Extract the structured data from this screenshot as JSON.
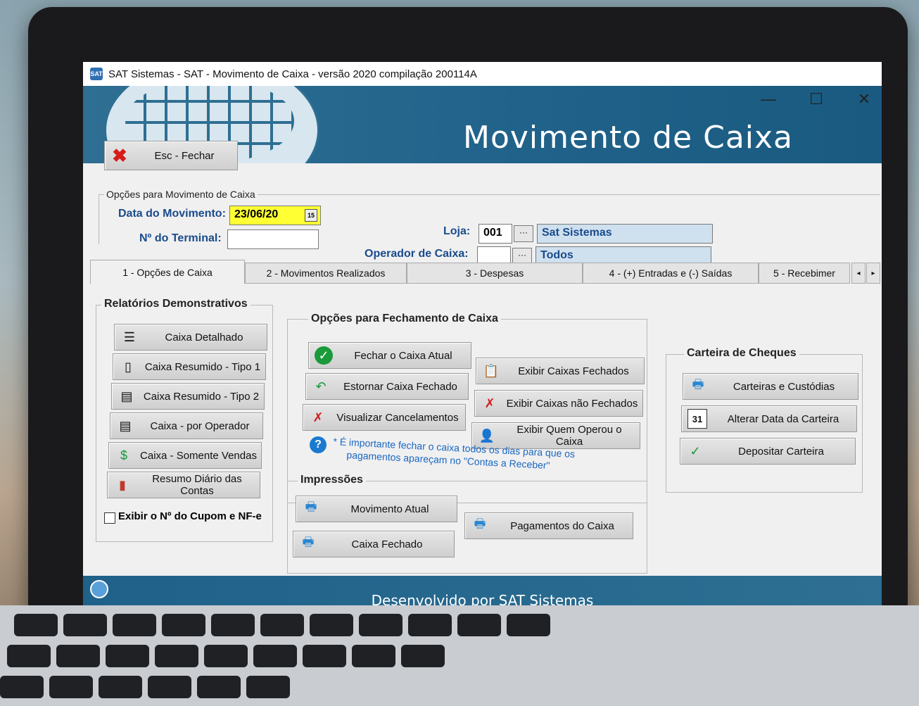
{
  "window": {
    "title": "SAT Sistemas - SAT - Movimento de Caixa - versão 2020 compilação 200114A",
    "minimize": "—",
    "maximize": "☐",
    "close": "✕"
  },
  "header": {
    "title": "Movimento de Caixa"
  },
  "close_button": {
    "label": "Esc - Fechar"
  },
  "options": {
    "group_label": "Opções para Movimento de Caixa",
    "data_label": "Data do Movimento:",
    "data_value": "23/06/20",
    "terminal_label": "Nº do Terminal:",
    "terminal_value": "",
    "loja_label": "Loja:",
    "loja_code": "001",
    "loja_name": "Sat Sistemas",
    "operador_label": "Operador de Caixa:",
    "operador_code": "",
    "operador_name": "Todos",
    "ellipsis": "···"
  },
  "tabs": [
    {
      "label": "1 - Opções de Caixa"
    },
    {
      "label": "2 - Movimentos Realizados"
    },
    {
      "label": "3 - Despesas"
    },
    {
      "label": "4 - (+) Entradas e (-) Saídas"
    },
    {
      "label": "5 - Recebimer"
    }
  ],
  "relatorios": {
    "title": "Relatórios Demonstrativos",
    "buttons": [
      {
        "label": "Caixa Detalhado"
      },
      {
        "label": "Caixa Resumido - Tipo 1"
      },
      {
        "label": "Caixa Resumido - Tipo 2"
      },
      {
        "label": "Caixa - por Operador"
      },
      {
        "label": "Caixa - Somente Vendas"
      },
      {
        "label": "Resumo Diário das Contas"
      }
    ],
    "checkbox_label": "Exibir o Nº do Cupom e NF-e"
  },
  "fechamento": {
    "title": "Opções para Fechamento de Caixa",
    "buttons": [
      {
        "label": "Fechar o Caixa Atual"
      },
      {
        "label": "Exibir Caixas Fechados"
      },
      {
        "label": "Estornar Caixa Fechado"
      },
      {
        "label": "Exibir Caixas não Fechados"
      },
      {
        "label": "Visualizar Cancelamentos"
      },
      {
        "label": "Exibir Quem Operou o Caixa"
      }
    ],
    "note_line1": "* É importante fechar o caixa todos os dias para que os",
    "note_line2": "pagamentos apareçam no \"Contas a Receber\""
  },
  "impressoes": {
    "title": "Impressões",
    "buttons": [
      {
        "label": "Movimento Atual"
      },
      {
        "label": "Pagamentos do Caixa"
      },
      {
        "label": "Caixa Fechado"
      }
    ]
  },
  "cheques": {
    "title": "Carteira de Cheques",
    "buttons": [
      {
        "label": "Carteiras e Custódias"
      },
      {
        "label": "Alterar Data da Carteira"
      },
      {
        "label": "Depositar Carteira"
      }
    ],
    "calendar_day": "31"
  },
  "footer": {
    "text": "Desenvolvido por SAT Sistemas"
  },
  "colors": {
    "header": "#1f6189",
    "yellow": "#ffff33",
    "blue_field": "#cfe0ef",
    "label_blue": "#1a4b8c"
  }
}
